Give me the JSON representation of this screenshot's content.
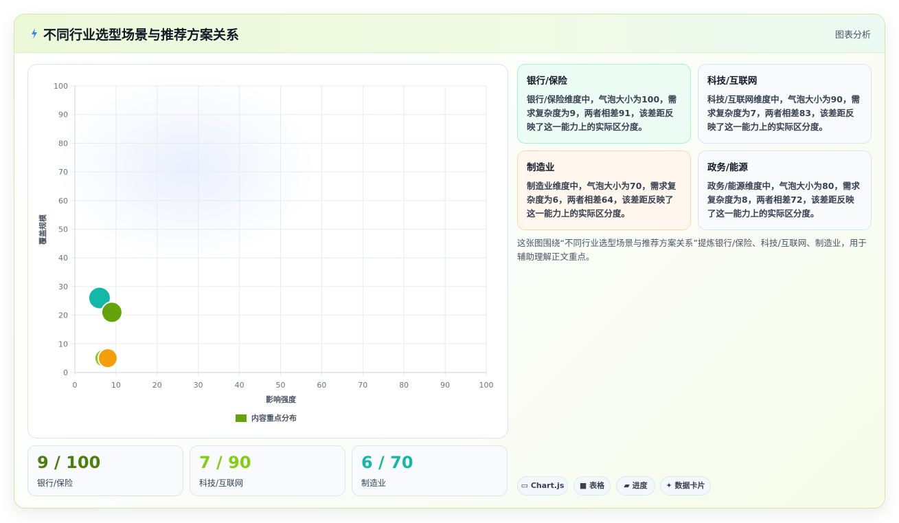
{
  "header": {
    "title": "不同行业选型场景与推荐方案关系",
    "tag": "图表分析"
  },
  "chart_data": {
    "type": "bubble",
    "xlabel": "影响强度",
    "ylabel": "覆盖规模",
    "xlim": [
      0,
      100
    ],
    "ylim": [
      0,
      100
    ],
    "xticks": [
      "0",
      "10",
      "20",
      "30",
      "40",
      "50",
      "60",
      "70",
      "80",
      "90",
      "100"
    ],
    "yticks": [
      "0",
      "10",
      "20",
      "30",
      "40",
      "50",
      "60",
      "70",
      "80",
      "90",
      "100"
    ],
    "grid": true,
    "legend": {
      "label": "内容重点分布",
      "color": "#65a30d",
      "position": "bottom"
    },
    "points": [
      {
        "x": 6,
        "y": 26,
        "r": 100,
        "color": "#14b8a6"
      },
      {
        "x": 9,
        "y": 21,
        "r": 90,
        "color": "#65a30d"
      },
      {
        "x": 7,
        "y": 5,
        "r": 70,
        "color": "#84cc16"
      },
      {
        "x": 8,
        "y": 5,
        "r": 80,
        "color": "#f59e0b"
      }
    ]
  },
  "stats": [
    {
      "value": "9 / 100",
      "label": "银行/保险",
      "color": "#4d7c0f"
    },
    {
      "value": "7 / 90",
      "label": "科技/互联网",
      "color": "#84cc16"
    },
    {
      "value": "6 / 70",
      "label": "制造业",
      "color": "#14b8a6"
    }
  ],
  "cards": [
    {
      "title": "银行/保险",
      "text": "银行/保险维度中，气泡大小为100，需求复杂度为9，两者相差91，该差距反映了这一能力上的实际区分度。",
      "bg": "#ecfdf5",
      "border": "#a7f3d0"
    },
    {
      "title": "科技/互联网",
      "text": "科技/互联网维度中，气泡大小为90，需求复杂度为7，两者相差83，该差距反映了这一能力上的实际区分度。",
      "bg": "#f8fafc",
      "border": "#dbe4ee"
    },
    {
      "title": "制造业",
      "text": "制造业维度中，气泡大小为70，需求复杂度为6，两者相差64，该差距反映了这一能力上的实际区分度。",
      "bg": "#fff7ed",
      "border": "#fed7aa"
    },
    {
      "title": "政务/能源",
      "text": "政务/能源维度中，气泡大小为80，需求复杂度为8，两者相差72，该差距反映了这一能力上的实际区分度。",
      "bg": "#f8fafc",
      "border": "#dbe4ee"
    }
  ],
  "description": "这张图围绕“不同行业选型场景与推荐方案关系”提炼银行/保险、科技/互联网、制造业，用于辅助理解正文重点。",
  "chips": [
    {
      "icon": "▭",
      "label": "Chart.js"
    },
    {
      "icon": "■",
      "label": "表格"
    },
    {
      "icon": "▰",
      "label": "进度"
    },
    {
      "icon": "✦",
      "label": "数据卡片"
    }
  ]
}
